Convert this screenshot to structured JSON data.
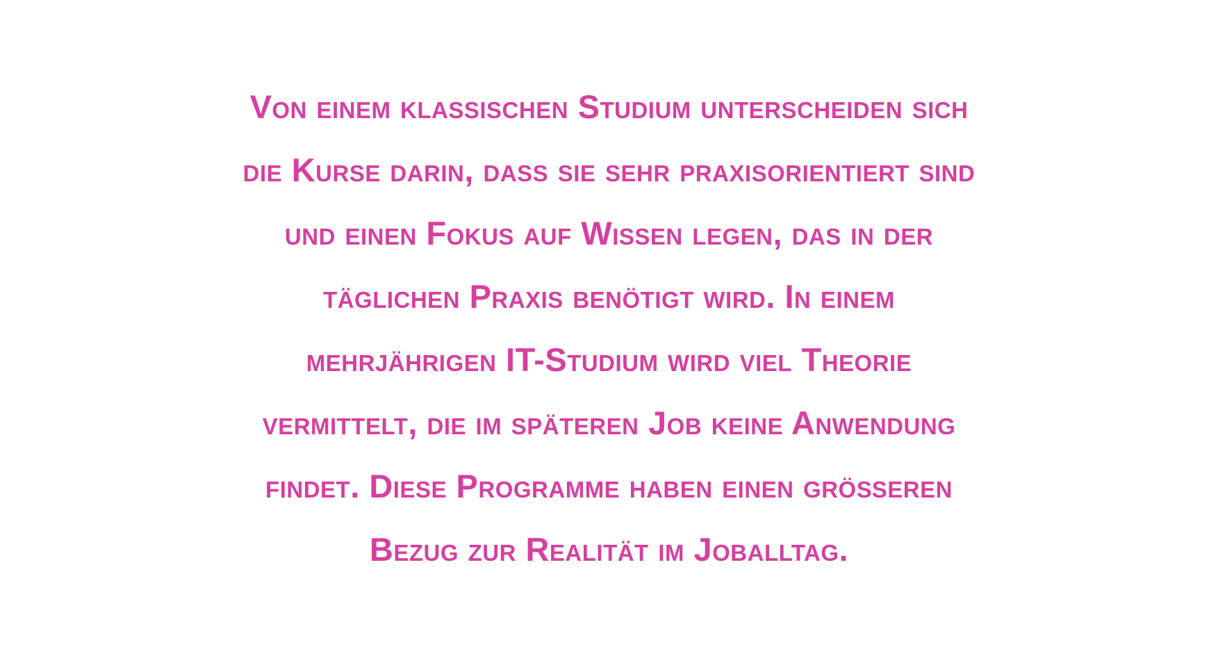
{
  "text": {
    "color": "#d5409f",
    "lines": [
      "Von einem klassischen Studium unterscheiden sich",
      "die Kurse darin, dass sie sehr praxisorientiert sind",
      "und einen Fokus auf Wissen legen, das in der",
      "täglichen Praxis benötigt wird. In einem",
      "mehrjährigen IT-Studium wird viel Theorie",
      "vermittelt, die im späteren Job keine Anwendung",
      "findet. Diese Programme haben einen größeren",
      "Bezug zur Realität im Joballtag."
    ]
  }
}
